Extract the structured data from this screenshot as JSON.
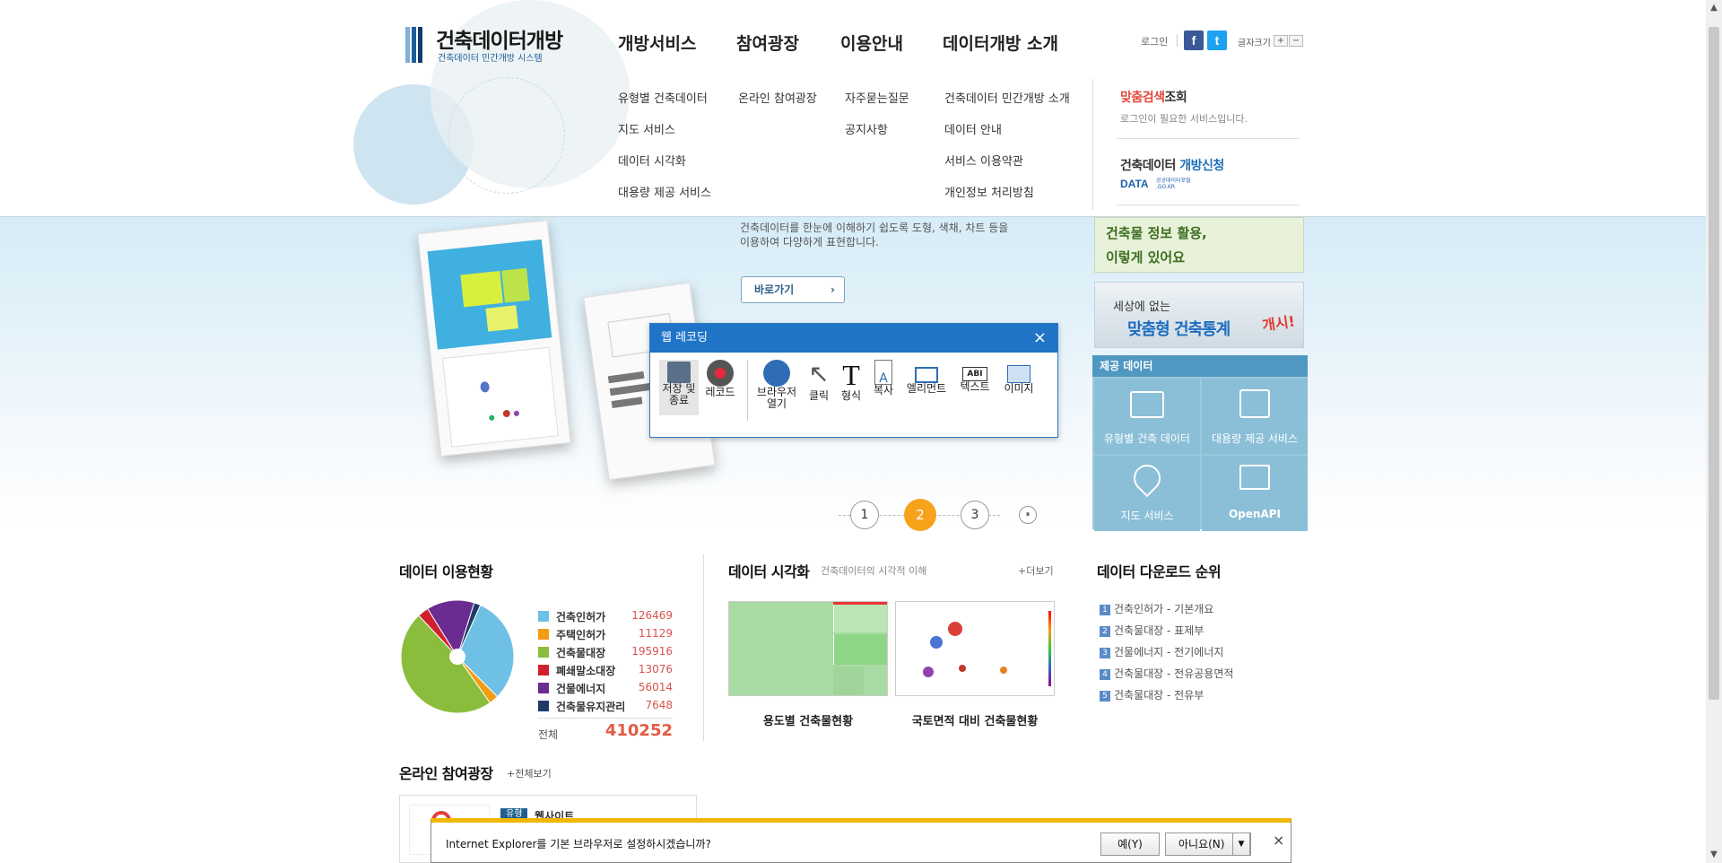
{
  "logo": {
    "title": "건축데이터개방",
    "subtitle": "건축데이터 민간개방 시스템"
  },
  "gnb": [
    "개방서비스",
    "참여광장",
    "이용안내",
    "데이터개방 소개"
  ],
  "submenu": {
    "col1": [
      "유형별 건축데이터",
      "지도 서비스",
      "데이터 시각화",
      "대용량 제공 서비스"
    ],
    "col2": [
      "온라인 참여광장"
    ],
    "col3": [
      "자주묻는질문",
      "공지사항"
    ],
    "col4": [
      "건축데이터 민간개방 소개",
      "데이터 안내",
      "서비스 이용약관",
      "개인정보 처리방침"
    ]
  },
  "util": {
    "login": "로그인",
    "fontsize": "글자크기",
    "plus": "+",
    "minus": "−"
  },
  "rightbox": {
    "search_a": "맞춤검색",
    "search_b": "조회",
    "search_note": "로그인이 필요한 서비스입니다.",
    "open_a": "건축데이터 ",
    "open_b": "개방신청",
    "data_logo": "DATA",
    "data_sub": "공공데이터포털\n.GO.KR"
  },
  "hero": {
    "desc": "건축데이터를 한눈에 이해하기 쉽도록 도형, 색채, 차트 등을\n이용하여 다양하게 표현합니다.",
    "go_button": "바로가기",
    "pager": [
      "1",
      "2",
      "3"
    ],
    "pause": "⏸"
  },
  "banners": {
    "b1": "건축물 정보 활용,\n이렇게 있어요",
    "b2_top": "세상에 없는",
    "b2_main": "맞춤형 건축통계",
    "b2_badge": "개시!"
  },
  "provide": {
    "title": "제공 데이터",
    "items": [
      "유형별 건축 데이터",
      "대용량 제공 서비스",
      "지도 서비스",
      "OpenAPI"
    ]
  },
  "recording": {
    "title": "웹 레코딩",
    "tools": [
      {
        "label": "저장 및\n종료",
        "icon": "save-icon"
      },
      {
        "label": "레코드",
        "icon": "record-icon"
      },
      {
        "label": "브라우저\n열기",
        "icon": "globe-icon"
      },
      {
        "label": "클릭",
        "icon": "cursor-icon"
      },
      {
        "label": "형식",
        "icon": "text-format-icon"
      },
      {
        "label": "복사",
        "icon": "copy-icon"
      },
      {
        "label": "엘리먼트",
        "icon": "element-icon"
      },
      {
        "label": "텍스트",
        "icon": "text-icon"
      },
      {
        "label": "이미지",
        "icon": "image-icon"
      }
    ]
  },
  "usage": {
    "title": "데이터 이용현황",
    "total_label": "전체",
    "total_value": "410252",
    "colors": [
      "#6ec1e4",
      "#f39c12",
      "#8bbd3c",
      "#d0202e",
      "#6b2c91",
      "#1f3a66"
    ]
  },
  "chart_data": {
    "type": "pie",
    "categories": [
      "건축인허가",
      "주택인허가",
      "건축물대장",
      "폐쇄말소대장",
      "건물에너지",
      "건축물유지관리"
    ],
    "values": [
      126469,
      11129,
      195916,
      13076,
      56014,
      7648
    ],
    "display_values": [
      "126469",
      "11129",
      "195916",
      "13076",
      "56014",
      "7648"
    ]
  },
  "viz": {
    "title": "데이터 시각화",
    "subtitle": "건축데이터의 시각적 이해",
    "more": "+더보기",
    "cap1": "용도별 건축물현황",
    "cap2": "국토면적 대비 건축물현황"
  },
  "download": {
    "title": "데이터 다운로드 순위",
    "items": [
      "건축인허가 - 기본개요",
      "건축물대장 - 표제부",
      "건물에너지 - 전기에너지",
      "건축물대장 - 전유공용면적",
      "건축물대장 - 전유부"
    ]
  },
  "online": {
    "title": "온라인 참여광장",
    "more": "+전체보기",
    "tag": "유형",
    "type": "웹사이트"
  },
  "iebar": {
    "msg": "Internet Explorer를 기본 브라우저로 설정하시겠습니까?",
    "yes": "예(Y)",
    "no": "아니요(N)",
    "close": "×"
  }
}
